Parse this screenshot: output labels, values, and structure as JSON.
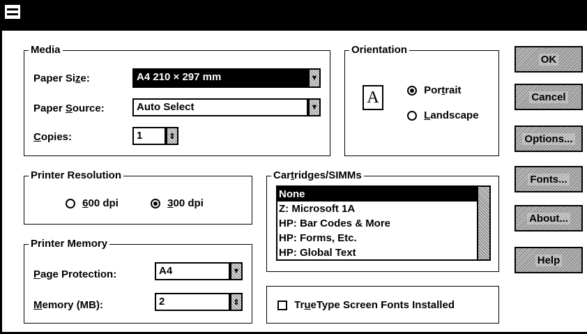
{
  "window": {
    "system_menu_icon": "system-menu-icon"
  },
  "media": {
    "legend": "Media",
    "paper_size": {
      "label_pre": "Paper Si",
      "label_u": "z",
      "label_post": "e:",
      "value": "A4 210 × 297 mm"
    },
    "paper_source": {
      "label_pre": "Paper ",
      "label_u": "S",
      "label_post": "ource:",
      "value": "Auto Select"
    },
    "copies": {
      "label_u": "C",
      "label_post": "opies:",
      "value": "1"
    }
  },
  "orientation": {
    "legend": "Orientation",
    "icon_letter": "A",
    "portrait": {
      "pre": "Por",
      "u": "t",
      "post": "rait",
      "selected": true
    },
    "landscape": {
      "pre": "",
      "u": "L",
      "post": "andscape",
      "selected": false
    }
  },
  "buttons": {
    "ok": "OK",
    "cancel": "Cancel",
    "options": "Options...",
    "fonts": "Fonts...",
    "about": "About...",
    "help": "Help"
  },
  "printer_resolution": {
    "legend": "Printer Resolution",
    "dpi600": {
      "u": "6",
      "post": "00 dpi",
      "selected": false
    },
    "dpi300": {
      "u": "3",
      "post": "00 dpi",
      "selected": true
    }
  },
  "cartridges": {
    "legend_pre": "Car",
    "legend_u": "t",
    "legend_post": "ridges/SIMMs",
    "items": [
      "None",
      "Z: Microsoft 1A",
      "HP: Bar Codes & More",
      "HP: Forms, Etc.",
      "HP: Global Text"
    ],
    "selected_index": 0
  },
  "printer_memory": {
    "legend": "Printer Memory",
    "page_protection": {
      "label_u": "P",
      "label_post": "age Protection:",
      "value": "A4"
    },
    "memory": {
      "label_u": "M",
      "label_post": "emory (MB):",
      "value": "2"
    }
  },
  "truetype": {
    "pre": "Tr",
    "u": "u",
    "post": "eType Screen Fonts Installed",
    "checked": false
  }
}
